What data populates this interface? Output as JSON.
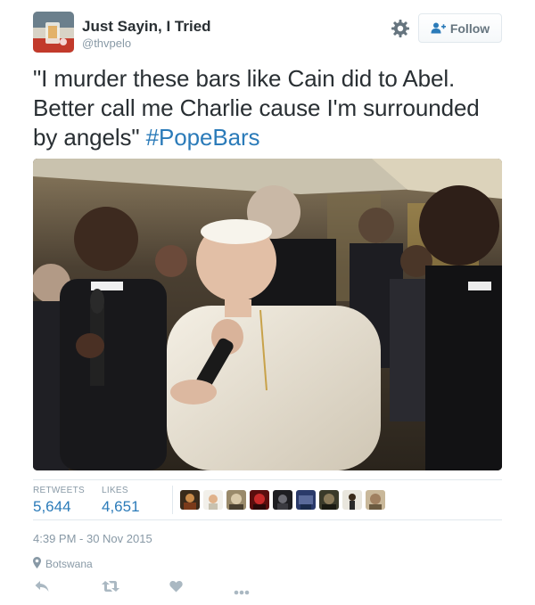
{
  "user": {
    "name": "Just Sayin, I Tried",
    "handle": "@thvpelo"
  },
  "header": {
    "follow_label": "Follow"
  },
  "tweet": {
    "text": "\"I murder these bars like Cain did to Abel. Better call me Charlie cause I'm surrounded by angels\" ",
    "hashtag": "#PopeBars"
  },
  "stats": {
    "retweets_label": "RETWEETS",
    "retweets_value": "5,644",
    "likes_label": "LIKES",
    "likes_value": "4,651"
  },
  "timestamp": "4:39 PM - 30 Nov 2015",
  "location": "Botswana",
  "colors": {
    "link": "#2b7bb9",
    "muted": "#8899a6",
    "text": "#292f33",
    "border": "#e1e8ed"
  },
  "icons": [
    "gear-icon",
    "follow-person-icon",
    "map-pin-icon",
    "reply-icon",
    "retweet-icon",
    "like-icon",
    "more-icon"
  ]
}
